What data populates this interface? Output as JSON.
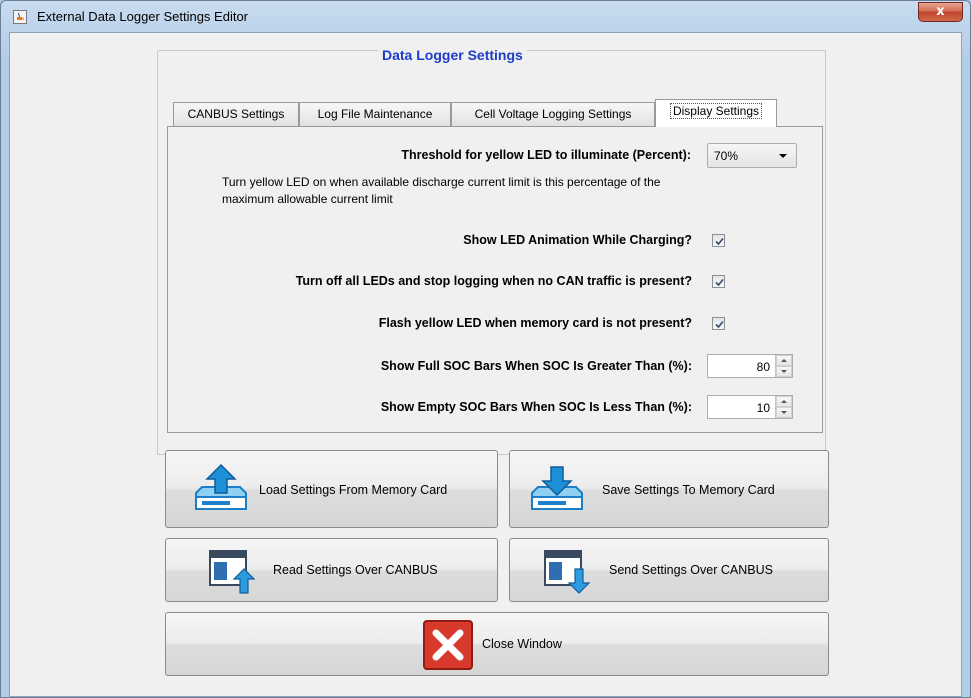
{
  "window": {
    "title": "External Data Logger Settings Editor",
    "close_glyph": "x",
    "icon": "java-cup-icon"
  },
  "group": {
    "title": "Data Logger Settings"
  },
  "tabs": [
    {
      "label": "CANBUS Settings",
      "active": false
    },
    {
      "label": "Log File Maintenance",
      "active": false
    },
    {
      "label": "Cell Voltage Logging Settings",
      "active": false
    },
    {
      "label": "Display Settings",
      "active": true
    }
  ],
  "display_settings": {
    "threshold_label": "Threshold for yellow LED to illuminate (Percent):",
    "threshold_value": "70%",
    "threshold_desc_line1": "Turn yellow LED on when available discharge current limit is this percentage of the",
    "threshold_desc_line2": "maximum allowable current limit",
    "led_animation_label": "Show LED Animation While Charging?",
    "led_animation_checked": true,
    "leds_off_label": "Turn off all LEDs and stop logging when no CAN traffic is present?",
    "leds_off_checked": true,
    "flash_yellow_label": "Flash yellow LED when memory card is not present?",
    "flash_yellow_checked": true,
    "full_soc_label": "Show Full SOC Bars When SOC Is Greater Than (%):",
    "full_soc_value": "80",
    "empty_soc_label": "Show Empty SOC Bars When SOC Is Less Than (%):",
    "empty_soc_value": "10"
  },
  "buttons": {
    "load_memory": "Load Settings From Memory Card",
    "save_memory": "Save Settings To Memory Card",
    "read_canbus": "Read Settings Over CANBUS",
    "send_canbus": "Send Settings Over CANBUS",
    "close": "Close Window"
  },
  "colors": {
    "group_title": "#1d3cc8",
    "close_red": "#c0432c",
    "icon_blue": "#1e90d8"
  }
}
